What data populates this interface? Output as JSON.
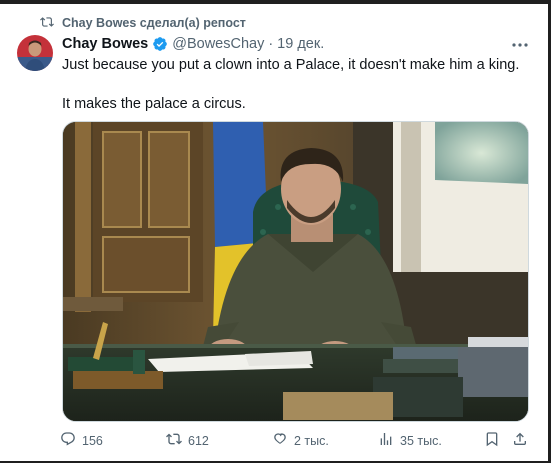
{
  "repost": {
    "text": "Chay Bowes сделал(а) репост",
    "icon": "repost-icon"
  },
  "tweet": {
    "author_name": "Chay Bowes",
    "author_handle": "@BowesChay",
    "separator": "·",
    "date": "19 дек.",
    "verified": true,
    "text_line_1": "Just because you put a clown into a Palace, it doesn't make him a king.",
    "text_line_2": "It makes the palace a circus.",
    "media": {
      "kind": "photo"
    }
  },
  "actions": {
    "replies": "156",
    "reposts": "612",
    "likes": "2 тыс.",
    "views": "35 тыс."
  },
  "colors": {
    "text": "#0f1419",
    "secondary": "#536471",
    "verified": "#1d9bf0"
  }
}
